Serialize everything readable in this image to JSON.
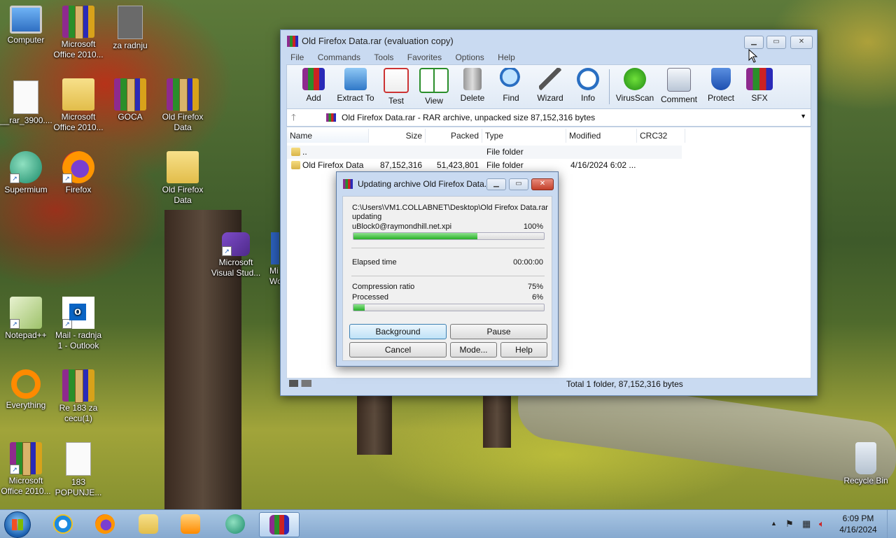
{
  "desktop": {
    "icons": [
      {
        "label": "Computer"
      },
      {
        "label": "Microsoft Office 2010..."
      },
      {
        "label": "za radnju"
      },
      {
        "label": "__rar_3900...."
      },
      {
        "label": "Microsoft Office 2010..."
      },
      {
        "label": "GOCA"
      },
      {
        "label": "Old Firefox Data"
      },
      {
        "label": "Supermium"
      },
      {
        "label": "Firefox"
      },
      {
        "label": "Old Firefox Data"
      },
      {
        "label": "Microsoft Visual Stud..."
      },
      {
        "label": "Mi Wo"
      },
      {
        "label": "Notepad++"
      },
      {
        "label": "Mail - radnja 1 - Outlook"
      },
      {
        "label": "Everything"
      },
      {
        "label": "Re 183 za cecu(1)"
      },
      {
        "label": "Microsoft Office 2010..."
      },
      {
        "label": "183 POPUNJE..."
      },
      {
        "label": "Recycle Bin"
      }
    ]
  },
  "winrar": {
    "title": "Old Firefox Data.rar (evaluation copy)",
    "menu": [
      "File",
      "Commands",
      "Tools",
      "Favorites",
      "Options",
      "Help"
    ],
    "toolbar": [
      "Add",
      "Extract To",
      "Test",
      "View",
      "Delete",
      "Find",
      "Wizard",
      "Info",
      "VirusScan",
      "Comment",
      "Protect",
      "SFX"
    ],
    "address": "Old Firefox Data.rar - RAR archive, unpacked size 87,152,316 bytes",
    "columns": [
      "Name",
      "Size",
      "Packed",
      "Type",
      "Modified",
      "CRC32"
    ],
    "rows": [
      {
        "name": "..",
        "size": "",
        "packed": "",
        "type": "File folder",
        "modified": ""
      },
      {
        "name": "Old Firefox Data",
        "size": "87,152,316",
        "packed": "51,423,801",
        "type": "File folder",
        "modified": "4/16/2024 6:02 ..."
      }
    ],
    "status": "Total 1 folder, 87,152,316 bytes"
  },
  "dialog": {
    "title": "Updating archive Old Firefox Data...",
    "path": "C:\\Users\\VM1.COLLABNET\\Desktop\\Old Firefox Data.rar",
    "action": "updating",
    "file": "uBlock0@raymondhill.net.xpi",
    "file_percent": "100%",
    "file_progress": 0.65,
    "elapsed_label": "Elapsed time",
    "elapsed_value": "00:00:00",
    "ratio_label": "Compression ratio",
    "ratio_value": "75%",
    "processed_label": "Processed",
    "processed_value": "6%",
    "processed_progress": 0.06,
    "buttons": {
      "background": "Background",
      "pause": "Pause",
      "cancel": "Cancel",
      "mode": "Mode...",
      "help": "Help"
    }
  },
  "taskbar": {
    "time": "6:09 PM",
    "date": "4/16/2024"
  }
}
